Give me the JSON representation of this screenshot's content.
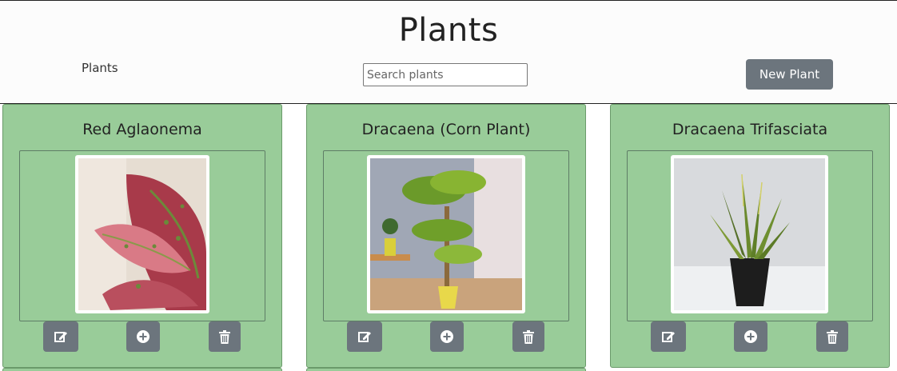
{
  "header": {
    "title": "Plants",
    "nav_link": "Plants",
    "search_placeholder": "Search plants",
    "new_plant_label": "New Plant"
  },
  "cards": [
    {
      "name": "Red Aglaonema",
      "actions": [
        "edit-icon",
        "plus-circle-icon",
        "trash-icon"
      ]
    },
    {
      "name": "Dracaena (Corn Plant)",
      "actions": [
        "edit-icon",
        "plus-circle-icon",
        "trash-icon"
      ]
    },
    {
      "name": "Dracaena Trifasciata",
      "actions": [
        "edit-icon",
        "plus-circle-icon",
        "trash-icon"
      ]
    }
  ],
  "colors": {
    "card_bg": "#99cc99",
    "button_bg": "#6c757d"
  }
}
